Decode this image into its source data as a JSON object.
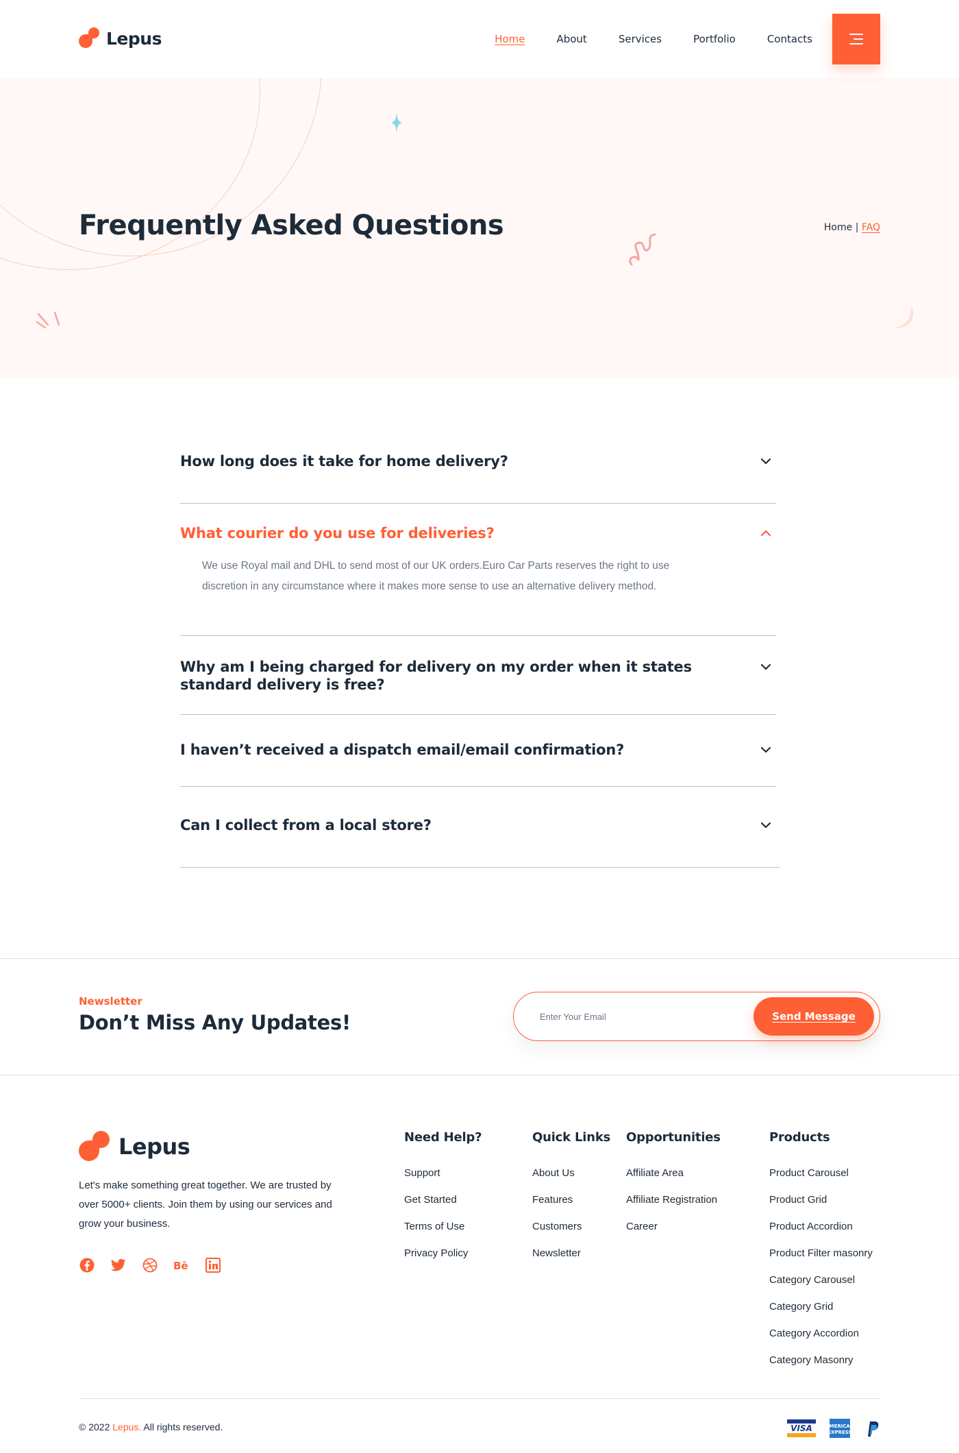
{
  "brand": {
    "name": "Lepus",
    "accent": "#ff5f35",
    "dark": "#1d2b3a"
  },
  "nav": {
    "items": [
      {
        "label": "Home"
      },
      {
        "label": "About"
      },
      {
        "label": "Services"
      },
      {
        "label": "Portfolio"
      },
      {
        "label": "Contacts"
      }
    ],
    "active_index": 0,
    "menu_icon": "hamburger-icon"
  },
  "hero": {
    "title": "Frequently Asked Questions",
    "breadcrumb": {
      "home": "Home",
      "separator": "|",
      "current": "FAQ"
    }
  },
  "faq": {
    "items": [
      {
        "question": "How long does it take for home delivery?",
        "open": false
      },
      {
        "question": "What courier do you use for deliveries?",
        "open": true,
        "answer": "We use Royal mail and DHL to send most of our UK orders.Euro Car Parts reserves the right to use discretion in any circumstance where it makes more sense to use an alternative delivery method."
      },
      {
        "question": "Why am I being charged for delivery on my order when it states standard delivery is free?",
        "open": false
      },
      {
        "question": "I haven’t received a dispatch email/email confirmation?",
        "open": false
      },
      {
        "question": "Can I collect from a local store?",
        "open": false
      }
    ]
  },
  "newsletter": {
    "label": "Newsletter",
    "title": "Don’t Miss Any Updates!",
    "placeholder": "Enter Your Email",
    "button": "Send Message"
  },
  "footer": {
    "about": "Let's make something great together. We are trusted by over 5000+ clients. Join them by using our services and grow your business.",
    "socials": [
      "facebook-icon",
      "twitter-icon",
      "dribbble-icon",
      "behance-icon",
      "linkedin-icon"
    ],
    "columns": [
      {
        "title": "Need Help?",
        "links": [
          "Support",
          "Get Started",
          "Terms of Use",
          "Privacy Policy"
        ]
      },
      {
        "title": "Quick Links",
        "links": [
          "About Us",
          "Features",
          "Customers",
          "Newsletter"
        ]
      },
      {
        "title": "Opportunities",
        "links": [
          "Affiliate Area",
          "Affiliate Registration",
          "Career"
        ]
      },
      {
        "title": "Products",
        "links": [
          "Product Carousel",
          "Product Grid",
          "Product Accordion",
          "Product Filter masonry",
          "Category Carousel",
          "Category Grid",
          "Category Accordion",
          "Category Masonry"
        ]
      }
    ],
    "copyright": {
      "prefix": "© 2022 ",
      "brand": "Lepus.",
      "suffix": " All rights reserved."
    },
    "payments": [
      "visa-icon",
      "amex-icon",
      "paypal-icon"
    ]
  }
}
